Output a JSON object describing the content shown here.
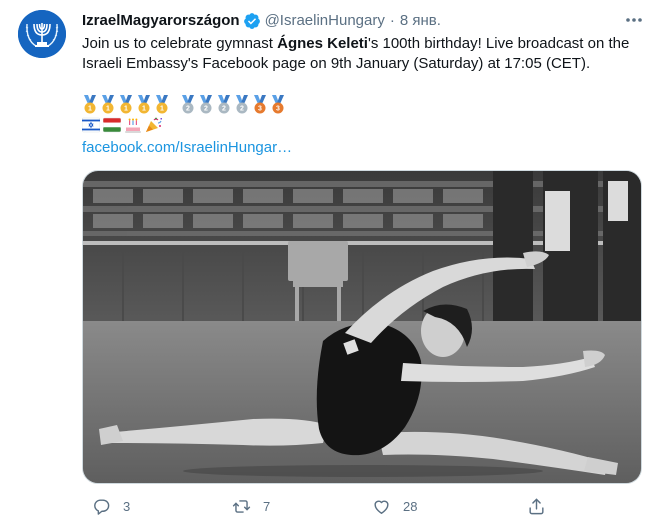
{
  "tweet": {
    "display_name": "IzraelMagyarországon",
    "handle": "@IsraelinHungary",
    "separator": "·",
    "time": "8 янв.",
    "text": {
      "part1": "Join us to celebrate gymnast ",
      "bold": "Ágnes Keleti",
      "part2": "'s 100th birthday! Live broadcast on the Israeli Embassy's Facebook page on 9th January (Saturday) at 17:05 (CET)."
    },
    "medals": [
      {
        "rank": "1",
        "color": "#f2b632"
      },
      {
        "rank": "1",
        "color": "#f2b632"
      },
      {
        "rank": "1",
        "color": "#f2b632"
      },
      {
        "rank": "1",
        "color": "#f2b632"
      },
      {
        "rank": "1",
        "color": "#f2b632"
      },
      {
        "rank": "2",
        "color": "#aab8c2"
      },
      {
        "rank": "2",
        "color": "#aab8c2"
      },
      {
        "rank": "2",
        "color": "#aab8c2"
      },
      {
        "rank": "2",
        "color": "#aab8c2"
      },
      {
        "rank": "3",
        "color": "#e67a2e"
      },
      {
        "rank": "3",
        "color": "#e67a2e"
      }
    ],
    "emoji_row2": [
      "israel-flag-icon",
      "hungary-flag-icon",
      "cake-icon",
      "party-popper-icon"
    ],
    "link": "facebook.com/IsraelinHungar…",
    "media_alt": "Black and white photo of a gymnast performing a split",
    "actions": {
      "replies": "3",
      "retweets": "7",
      "likes": "28"
    }
  },
  "colors": {
    "text": "#0f1419",
    "secondary": "#5b7083",
    "link": "#1b95e0",
    "verified": "#1da1f2",
    "avatar_bg": "#1565c0"
  }
}
